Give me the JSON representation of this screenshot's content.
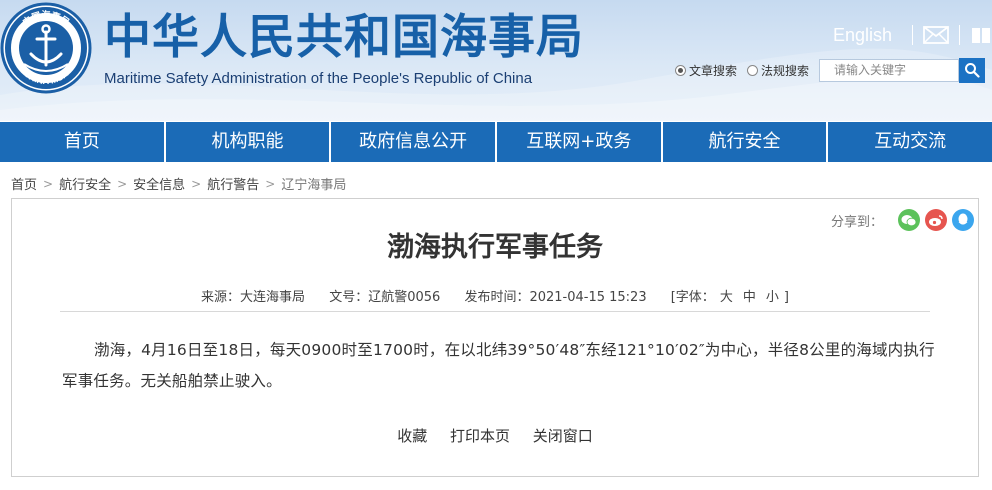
{
  "header": {
    "title_cn": "中华人民共和国海事局",
    "title_en": "Maritime Safety Administration of the People's Republic of China",
    "logo_text_top": "中国海事局",
    "logo_text_bottom": "CHINA MSA",
    "english_link": "English",
    "mail_icon": "mail-icon",
    "book_icon": "book-icon"
  },
  "search": {
    "options": [
      "文章搜索",
      "法规搜索"
    ],
    "selected": "文章搜索",
    "placeholder": "请输入关键字"
  },
  "nav": [
    "首页",
    "机构职能",
    "政府信息公开",
    "互联网+政务",
    "航行安全",
    "互动交流"
  ],
  "breadcrumb": [
    "首页",
    "航行安全",
    "安全信息",
    "航行警告",
    "辽宁海事局"
  ],
  "share": {
    "label": "分享到：",
    "icons": [
      "wechat-icon",
      "weibo-icon",
      "qq-icon"
    ],
    "colors": [
      "#5cc25b",
      "#e6554f",
      "#3ba6ee"
    ]
  },
  "article": {
    "title": "渤海执行军事任务",
    "source": "来源：大连海事局",
    "doc_no": "文号：辽航警0056",
    "publish_time": "发布时间：2021-04-15 15:23",
    "font_label": "[字体：",
    "font_sizes": [
      "大",
      "中",
      "小"
    ],
    "font_close": "]",
    "body": "渤海，4月16日至18日，每天0900时至1700时，在以北纬39°50′48″东经121°10′02″为中心，半径8公里的海域内执行军事任务。无关船舶禁止驶入。"
  },
  "actions": [
    "收藏",
    "打印本页",
    "关闭窗口"
  ],
  "colors": {
    "nav_bg": "#1b6bb7",
    "title_blue": "#1760a8"
  }
}
